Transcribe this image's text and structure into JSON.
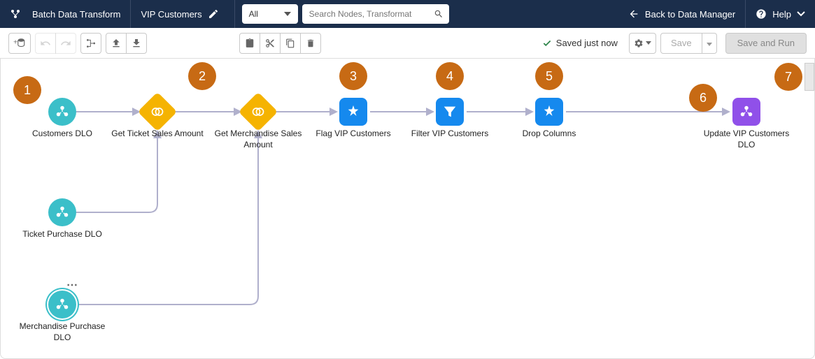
{
  "header": {
    "appName": "Batch Data Transform",
    "docName": "VIP Customers",
    "filterSelected": "All",
    "searchPlaceholder": "Search Nodes, Transformat",
    "backLabel": "Back to Data Manager",
    "helpLabel": "Help"
  },
  "toolbar": {
    "saveStatus": "Saved just now",
    "saveLabel": "Save",
    "saveRunLabel": "Save and Run"
  },
  "nodes": {
    "customersDLO": "Customers DLO",
    "getTicketSales": "Get Ticket Sales Amount",
    "getMerchSales": "Get Merchandise Sales Amount",
    "flagVIP": "Flag VIP Customers",
    "filterVIP": "Filter VIP Customers",
    "dropCols": "Drop Columns",
    "updateVIP": "Update VIP Customers DLO",
    "ticketPurchase": "Ticket Purchase DLO",
    "merchPurchase": "Merchandise Purchase DLO"
  },
  "callouts": {
    "c1": "1",
    "c2": "2",
    "c3": "3",
    "c4": "4",
    "c5": "5",
    "c6": "6",
    "c7": "7"
  }
}
